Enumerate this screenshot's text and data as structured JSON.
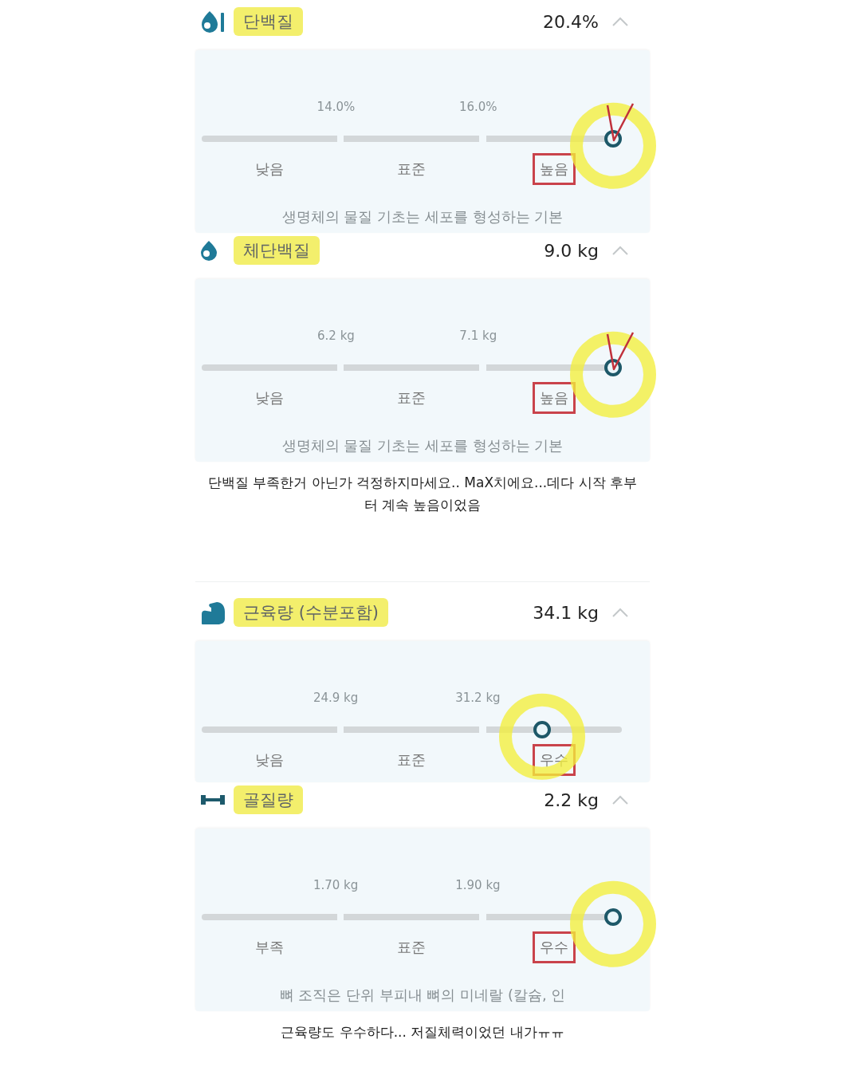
{
  "metrics": [
    {
      "kind": "protein",
      "name": "단백질",
      "highlighted": true,
      "value": "20.4%",
      "expanded": true,
      "thresholds": [
        "14.0%",
        "16.0%"
      ],
      "level": 0.98,
      "circled": true,
      "ticked": true,
      "bands": [
        {
          "label": "낮음",
          "boxed": false
        },
        {
          "label": "표준",
          "boxed": false
        },
        {
          "label": "높음",
          "boxed": true
        }
      ],
      "description": "생명체의 물질 기초는 세포를 형성하는 기본"
    },
    {
      "kind": "body-protein",
      "name": "체단백질",
      "highlighted": true,
      "value": "9.0 kg",
      "expanded": true,
      "thresholds": [
        "6.2 kg",
        "7.1 kg"
      ],
      "level": 0.98,
      "circled": true,
      "ticked": true,
      "bands": [
        {
          "label": "낮음",
          "boxed": false
        },
        {
          "label": "표준",
          "boxed": false
        },
        {
          "label": "높음",
          "boxed": true
        }
      ],
      "description": "생명체의 물질 기초는 세포를 형성하는 기본",
      "note": [
        "단백질 부족한거 아닌가 걱정하지마세요.. MaX치에요...데다 시작 후부",
        "터 계속 높음이었음"
      ]
    },
    {
      "kind": "muscle",
      "name": "근육량 (수분포함)",
      "highlighted": true,
      "value": "34.1 kg",
      "expanded": true,
      "thresholds": [
        "24.9 kg",
        "31.2 kg"
      ],
      "level": 0.81,
      "circled": true,
      "bands": [
        {
          "label": "낮음",
          "boxed": false
        },
        {
          "label": "표준",
          "boxed": false
        },
        {
          "label": "우수",
          "boxed": true
        }
      ]
    },
    {
      "kind": "bone",
      "name": "골질량",
      "highlighted": true,
      "value": "2.2 kg",
      "expanded": true,
      "thresholds": [
        "1.70 kg",
        "1.90 kg"
      ],
      "level": 0.98,
      "circled": true,
      "bands": [
        {
          "label": "부족",
          "boxed": false
        },
        {
          "label": "표준",
          "boxed": false
        },
        {
          "label": "우수",
          "boxed": true
        }
      ],
      "description": "뼈 조직은 단위 부피내 뼈의 미네랄 (칼슘, 인",
      "note": [
        "근육량도 우수하다... 저질체력이었던 내가ㅠㅠ"
      ]
    }
  ]
}
